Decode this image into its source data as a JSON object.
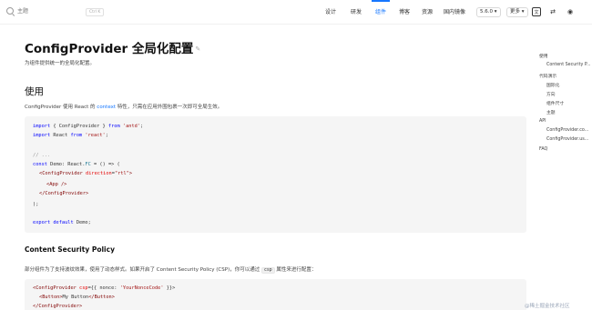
{
  "header": {
    "search_placeholder": "主题",
    "shortcut": "Ctrl K",
    "nav": [
      "设计",
      "研发",
      "组件",
      "博客",
      "资源",
      "国内镜像"
    ],
    "active_nav": "组件",
    "version": "5.6.0",
    "version_chevron": "▾",
    "more": "更多",
    "more_chevron": "▾",
    "icons": [
      "language-switch-icon",
      "direction-switch-icon",
      "github-icon"
    ],
    "lang_glyph": "文",
    "dir_glyph": "⇄",
    "github_glyph": "◉"
  },
  "main": {
    "title": "ConfigProvider 全局化配置",
    "edit_glyph": "✎",
    "subtitle": "为组件提供统一的全局化配置。",
    "section_usage": "使用",
    "usage_text_before": "ConfigProvider 使用 React 的",
    "usage_link": "context",
    "usage_text_after": "特性，只需在应用外围包裹一次即可全局生效。",
    "code1": {
      "l1_kw": "import",
      "l1_a": " { ConfigProvider } ",
      "l1_kw2": "from",
      "l1_str": " 'antd'",
      "l1_end": ";",
      "l2_kw": "import",
      "l2_a": " React ",
      "l2_kw2": "from",
      "l2_str": " 'react'",
      "l2_end": ";",
      "l3": "// ...",
      "l4_kw": "const",
      "l4_a": " Demo: React.",
      "l4_ty": "FC",
      "l4_b": " = () => (",
      "l5_tag": "<ConfigProvider",
      "l5_attr": " direction",
      "l5_eq": "=",
      "l5_str": "\"rtl\"",
      "l5_end": ">",
      "l6": "<App />",
      "l7": "</ConfigProvider>",
      "l8": ");",
      "l9_kw": "export default",
      "l9_a": " Demo;"
    },
    "section_csp": "Content Security Policy",
    "csp_text_before": "部分组件为了支持波纹效果，使用了动态样式。如果开启了 Content Security Policy (CSP)，你可以通过",
    "csp_code": "csp",
    "csp_text_after": "属性来进行配置：",
    "code2": {
      "l1_tag": "<ConfigProvider",
      "l1_attr": " csp",
      "l1_rest": "={{ nonce: ",
      "l1_str": "'YourNonceCode'",
      "l1_end": " }}>",
      "l2_tag": "<Button>",
      "l2_text": "My Button",
      "l2_tag2": "</Button>",
      "l3": "</ConfigProvider>"
    }
  },
  "anchor": {
    "items": [
      "使用",
      "Content Security P...",
      "代码演示",
      "国际化",
      "方向",
      "组件尺寸",
      "主题",
      "API",
      "ConfigProvider.co...",
      "ConfigProvider.us...",
      "FAQ"
    ]
  },
  "watermark": "@稀土掘金技术社区",
  "colors": {
    "accent": "#1677ff",
    "code_bg": "#f5f5f5"
  }
}
